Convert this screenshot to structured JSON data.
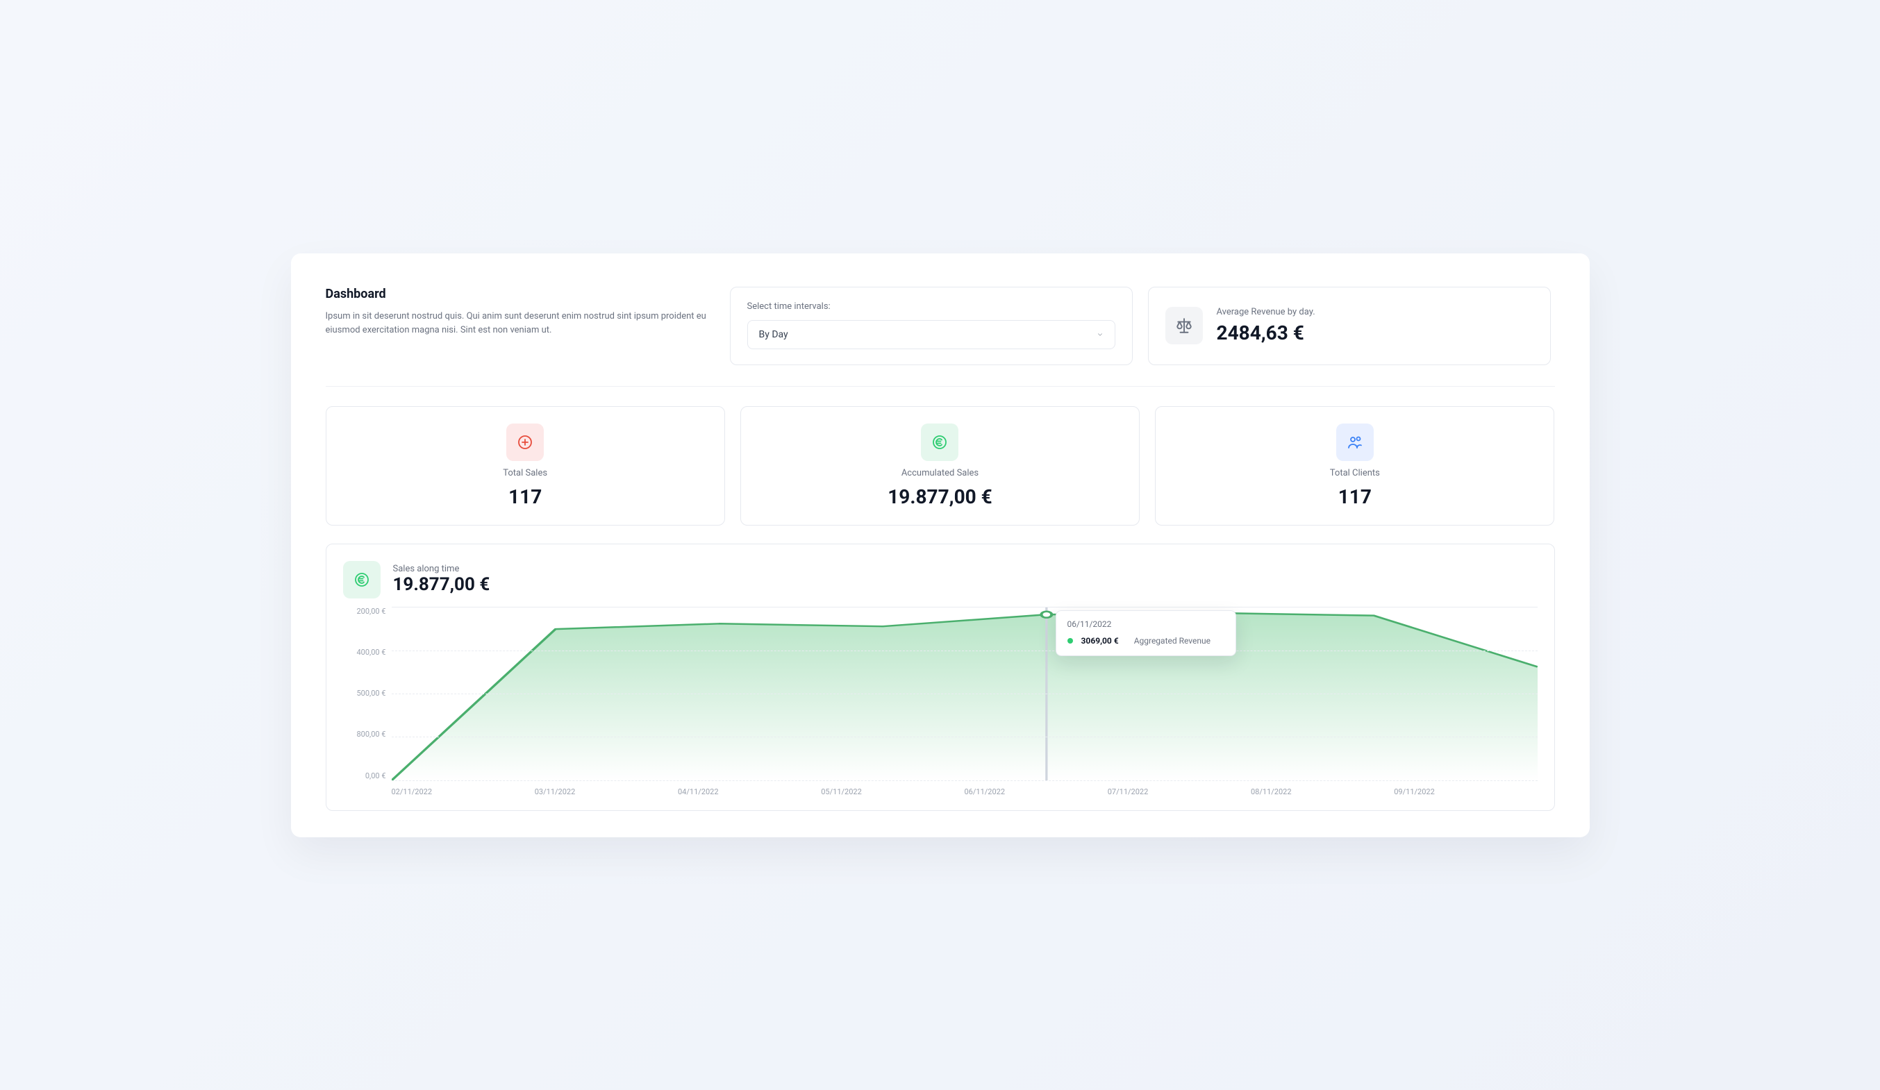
{
  "header": {
    "title": "Dashboard",
    "description": "Ipsum in sit deserunt nostrud quis. Qui anim sunt deserunt enim nostrud sint ipsum proident eu eiusmod exercitation magna nisi. Sint est non veniam ut."
  },
  "interval": {
    "label": "Select time intervals:",
    "selected": "By Day"
  },
  "average": {
    "label": "Average Revenue by day.",
    "value": "2484,63 €"
  },
  "stats": [
    {
      "icon": "plus-circle",
      "color": "red",
      "label": "Total Sales",
      "value": "117"
    },
    {
      "icon": "euro",
      "color": "green",
      "label": "Accumulated Sales",
      "value": "19.877,00 €"
    },
    {
      "icon": "users",
      "color": "blue",
      "label": "Total Clients",
      "value": "117"
    }
  ],
  "chart": {
    "title": "Sales along time",
    "total": "19.877,00 €",
    "y_ticks": [
      "200,00 €",
      "400,00 €",
      "500,00 €",
      "800,00 €",
      "0,00 €"
    ],
    "tooltip": {
      "date": "06/11/2022",
      "value": "3069,00 €",
      "series": "Aggregated Revenue"
    }
  },
  "chart_data": {
    "type": "line",
    "title": "Sales along time",
    "xlabel": "",
    "ylabel": "",
    "categories": [
      "02/11/2022",
      "03/11/2022",
      "04/11/2022",
      "05/11/2022",
      "06/11/2022",
      "07/11/2022",
      "08/11/2022",
      "09/11/2022"
    ],
    "series": [
      {
        "name": "Aggregated Revenue",
        "values": [
          0,
          2800,
          2900,
          2850,
          3069,
          3100,
          3050,
          2100
        ]
      }
    ],
    "ylim": [
      0,
      3200
    ],
    "tooltip_point": {
      "x": "06/11/2022",
      "value": 3069,
      "display": "3069,00 €"
    }
  }
}
